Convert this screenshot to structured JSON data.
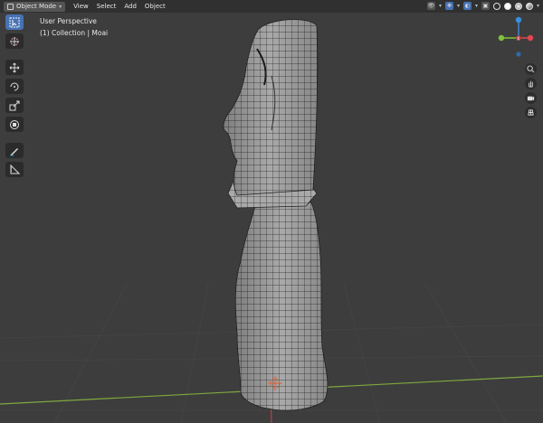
{
  "header": {
    "mode_label": "Object Mode",
    "menu": [
      "View",
      "Select",
      "Add",
      "Object"
    ]
  },
  "viewport": {
    "view_name": "User Perspective",
    "active_object": "(1) Collection | Moai"
  },
  "gizmo": {
    "x": "X",
    "y": "Y",
    "z": "Z"
  },
  "toolbar": {
    "tools": [
      "select-box",
      "cursor",
      "move",
      "rotate",
      "scale",
      "transform",
      "annotate",
      "measure"
    ],
    "active": "select-box"
  },
  "nav_buttons": [
    "zoom",
    "pan",
    "camera",
    "perspective"
  ],
  "colors": {
    "background": "#3d3d3d",
    "header": "#303030",
    "accent": "#4772b3",
    "x_axis": "#e5474f",
    "y_axis": "#80c23a",
    "z_axis": "#3a8fe0"
  }
}
